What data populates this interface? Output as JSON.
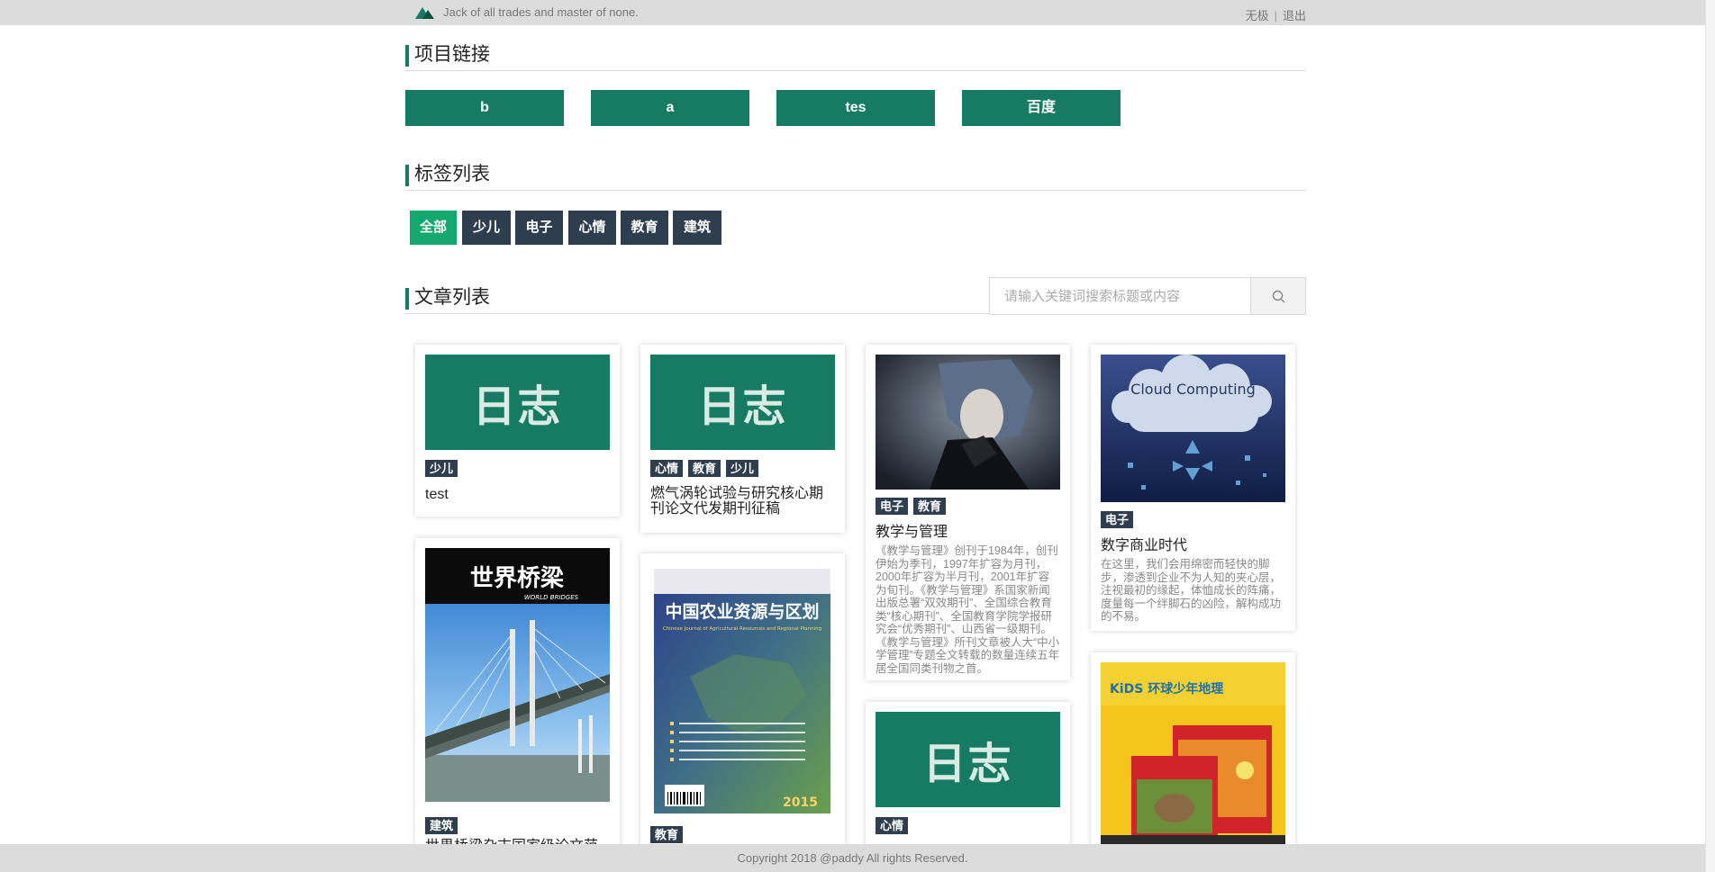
{
  "header": {
    "tagline": "Jack of all trades and master of none.",
    "user_link": "无极",
    "separator": "|",
    "logout_link": "退出"
  },
  "projects": {
    "title": "项目链接",
    "links": [
      "b",
      "a",
      "tes",
      "百度"
    ]
  },
  "tags": {
    "title": "标签列表",
    "items": [
      "全部",
      "少儿",
      "电子",
      "心情",
      "教育",
      "建筑"
    ],
    "active": "全部"
  },
  "articles": {
    "title": "文章列表",
    "search_placeholder": "请输入关键词搜索标题或内容",
    "cards": [
      {
        "thumb_text": "日志",
        "tags": [
          "少儿"
        ],
        "title": "test"
      },
      {
        "thumb_text": "日志",
        "tags": [
          "心情",
          "教育",
          "少儿"
        ],
        "title": "燃气涡轮试验与研究核心期刊论文代发期刊征稿"
      },
      {
        "tags": [
          "电子",
          "教育"
        ],
        "title": "教学与管理",
        "desc": "《教学与管理》创刊于1984年，创刊伊始为季刊，1997年扩容为月刊，2000年扩容为半月刊，2001年扩容为旬刊。《教学与管理》系国家新闻出版总署“双效期刊”、全国综合教育类“核心期刊”、全国教育学院学报研究会“优秀期刊”、山西省一级期刊。《教学与管理》所刊文章被人大“中小学管理”专题全文转载的数量连续五年居全国同类刊物之首。"
      },
      {
        "thumb_text": "Cloud Computing",
        "tags": [
          "电子"
        ],
        "title": "数字商业时代",
        "desc": "在这里，我们会用绵密而轻快的脚步，渗透到企业不为人知的夹心层，注视最初的缘起，体恤成长的阵痛，度量每一个绊脚石的凶险，解构成功的不易。"
      },
      {
        "thumb_text": "世界桥梁",
        "thumb_subtext": "WORLD BRIDGES",
        "tags": [
          "建筑"
        ],
        "title": "世界桥梁杂志国家级论文范"
      },
      {
        "thumb_text": "中国农业资源与区划",
        "thumb_subtext": "Chinese Journal of Agricultural Resources and Regional Planning",
        "thumb_year": "2015",
        "tags": [
          "教育"
        ]
      },
      {
        "thumb_text": "日志",
        "tags": [
          "心情"
        ]
      },
      {
        "thumb_text": "KiDS 环球少年地理",
        "tags": []
      }
    ]
  },
  "footer": {
    "copyright": "Copyright 2018 @paddy All rights Reserved."
  }
}
